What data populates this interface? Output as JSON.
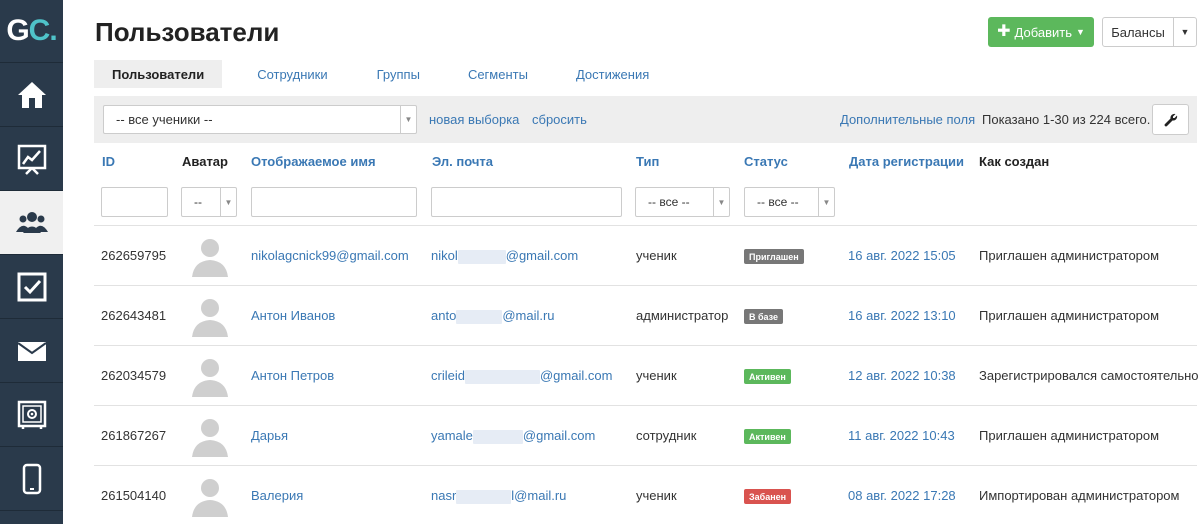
{
  "logo": {
    "g": "G",
    "c": "C",
    "dot": "."
  },
  "sidebar": {
    "items": [
      {
        "icon": "home-icon",
        "active": false
      },
      {
        "icon": "chart-icon",
        "active": false
      },
      {
        "icon": "users-icon",
        "active": true
      },
      {
        "icon": "checkbox-icon",
        "active": false
      },
      {
        "icon": "mail-icon",
        "active": false
      },
      {
        "icon": "safe-icon",
        "active": false
      },
      {
        "icon": "phone-icon",
        "active": false
      }
    ]
  },
  "header": {
    "title": "Пользователи",
    "add_label": "Добавить",
    "balances_label": "Балансы"
  },
  "tabs": [
    {
      "label": "Пользователи",
      "active": true
    },
    {
      "label": "Сотрудники",
      "active": false
    },
    {
      "label": "Группы",
      "active": false
    },
    {
      "label": "Сегменты",
      "active": false
    },
    {
      "label": "Достижения",
      "active": false
    }
  ],
  "filterbar": {
    "segment_value": "-- все ученики --",
    "new_selection": "новая выборка",
    "reset": "сбросить",
    "extra_fields": "Дополнительные поля",
    "shown": "Показано 1-30 из 224 всего."
  },
  "table": {
    "columns": [
      "ID",
      "Аватар",
      "Отображаемое имя",
      "Эл. почта",
      "Тип",
      "Статус",
      "Дата регистрации",
      "Как создан"
    ],
    "filters": {
      "avatar": "--",
      "type": "-- все --",
      "status": "-- все --"
    },
    "rows": [
      {
        "id": "262659795",
        "name": "nikolagcnick99@gmail.com",
        "email_start": "nikol",
        "email_end": "@gmail.com",
        "type": "ученик",
        "status": "Приглашен",
        "status_color": "#777777",
        "date": "16 авг. 2022 15:05",
        "created": "Приглашен администратором"
      },
      {
        "id": "262643481",
        "name": "Антон Иванов",
        "email_start": "anto",
        "email_end": "@mail.ru",
        "type": "администратор",
        "status": "В базе",
        "status_color": "#777777",
        "date": "16 авг. 2022 13:10",
        "created": "Приглашен администратором"
      },
      {
        "id": "262034579",
        "name": "Антон Петров",
        "email_start": "crileid",
        "email_end": "@gmail.com",
        "type": "ученик",
        "status": "Активен",
        "status_color": "#5cb85c",
        "date": "12 авг. 2022 10:38",
        "created": "Зарегистрировался самостоятельно"
      },
      {
        "id": "261867267",
        "name": "Дарья",
        "email_start": "yamale",
        "email_end": "@gmail.com",
        "type": "сотрудник",
        "status": "Активен",
        "status_color": "#5cb85c",
        "date": "11 авг. 2022 10:43",
        "created": "Приглашен администратором"
      },
      {
        "id": "261504140",
        "name": "Валерия",
        "email_start": "nasr",
        "email_end": "l@mail.ru",
        "type": "ученик",
        "status": "Забанен",
        "status_color": "#d9534f",
        "date": "08 авг. 2022 17:28",
        "created": "Импортирован администратором"
      }
    ]
  }
}
